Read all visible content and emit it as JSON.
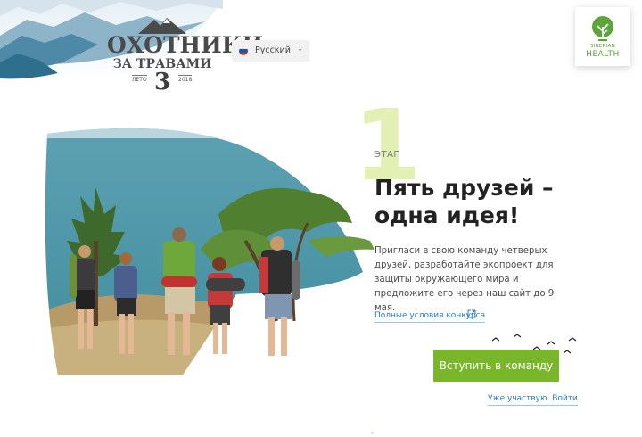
{
  "logo": {
    "line1": "ОХОТНИКИ",
    "line2": "ЗА ТРАВАМИ",
    "season": "ЛЕТО",
    "year": "2018",
    "number": "3"
  },
  "language": {
    "selected": "Русский",
    "flag": [
      "#ffffff",
      "#1c57a5",
      "#d52b1e"
    ]
  },
  "brand": {
    "line1": "SIBERIAN",
    "line2": "HEALTH",
    "color": "#5ea43d"
  },
  "stage": {
    "number": "1",
    "label": "ЭТАП"
  },
  "content": {
    "headline": "Пять друзей – одна идея!",
    "description": "Пригласи в свою команду четверых друзей, разработайте экопроект для защиты окружающего мира и предложите его через наш сайт до 9 мая.",
    "terms_link": "Полные условия конкурса",
    "join_button": "Вступить в команду",
    "login_link": "Уже участвую. Войти"
  },
  "colors": {
    "accent_green": "#79b62c",
    "link_blue": "#2a7cc0",
    "stage_digit": "#d9ec9a"
  }
}
